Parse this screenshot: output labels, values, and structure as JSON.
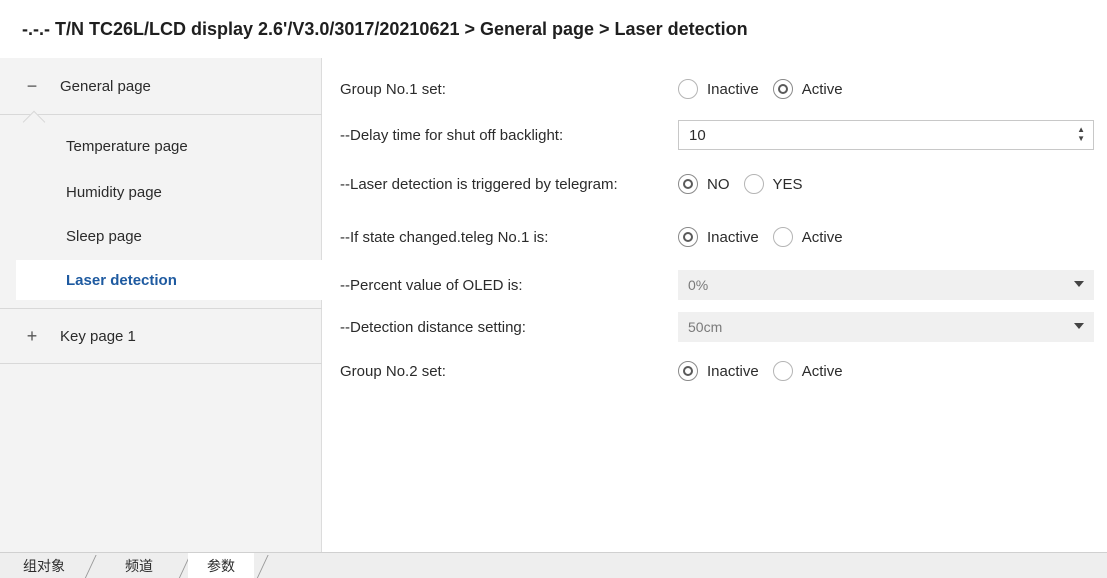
{
  "breadcrumb": "-.-.- T/N TC26L/LCD display 2.6'/V3.0/3017/20210621 > General page > Laser detection",
  "sidebar": {
    "groups": [
      {
        "sign": "−",
        "label": "General page"
      },
      {
        "sign": "+",
        "label": "Key page 1"
      }
    ],
    "items": [
      {
        "label": "Temperature page"
      },
      {
        "label": "Humidity page"
      },
      {
        "label": "Sleep page"
      },
      {
        "label": "Laser detection"
      }
    ]
  },
  "params": {
    "group1": {
      "label": "Group No.1 set:",
      "options": [
        "Inactive",
        "Active"
      ],
      "selected": "Active"
    },
    "delay": {
      "label": "--Delay time for shut off backlight:",
      "value": "10"
    },
    "laser_trig": {
      "label": "--Laser detection is triggered by telegram:",
      "options": [
        "NO",
        "YES"
      ],
      "selected": "NO"
    },
    "state_changed": {
      "label": "--If state changed.teleg No.1 is:",
      "options": [
        "Inactive",
        "Active"
      ],
      "selected": "Inactive"
    },
    "percent": {
      "label": "--Percent value of OLED is:",
      "value": "0%"
    },
    "distance": {
      "label": "--Detection distance setting:",
      "value": "50cm"
    },
    "group2": {
      "label": "Group No.2 set:",
      "options": [
        "Inactive",
        "Active"
      ],
      "selected": "Inactive"
    }
  },
  "bottom_tabs": [
    "组对象",
    "频道",
    "参数"
  ],
  "active_tab": "参数"
}
